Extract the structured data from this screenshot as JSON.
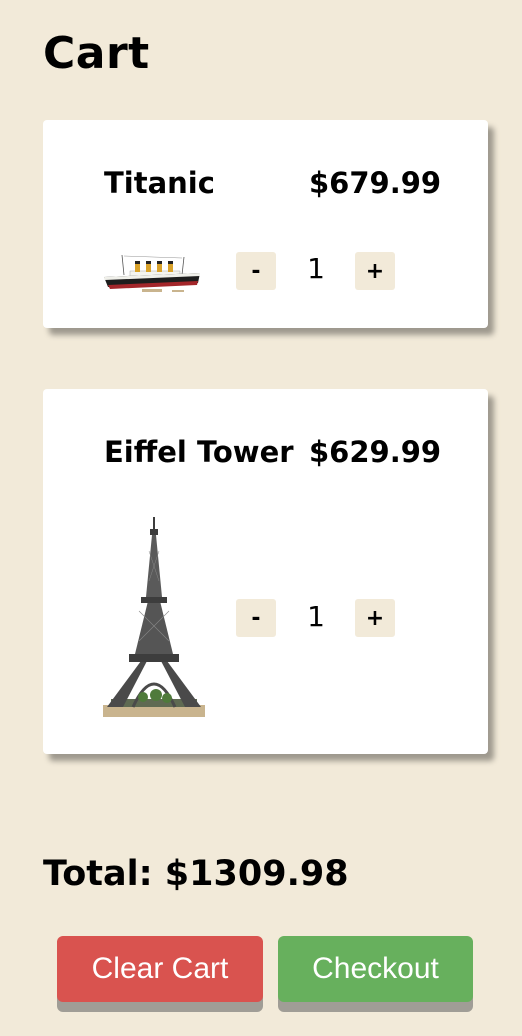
{
  "page": {
    "title": "Cart"
  },
  "cart": {
    "items": [
      {
        "name": "Titanic",
        "price": "$679.99",
        "quantity": "1",
        "image": "titanic-ship-model"
      },
      {
        "name": "Eiffel Tower",
        "price": "$629.99",
        "quantity": "1",
        "image": "eiffel-tower-model"
      }
    ],
    "decrement_label": "-",
    "increment_label": "+",
    "total": "Total: $1309.98"
  },
  "actions": {
    "clear_label": "Clear Cart",
    "checkout_label": "Checkout"
  },
  "colors": {
    "background": "#f2ead9",
    "card": "#ffffff",
    "clear_button": "#d9534f",
    "checkout_button": "#67b05d"
  }
}
